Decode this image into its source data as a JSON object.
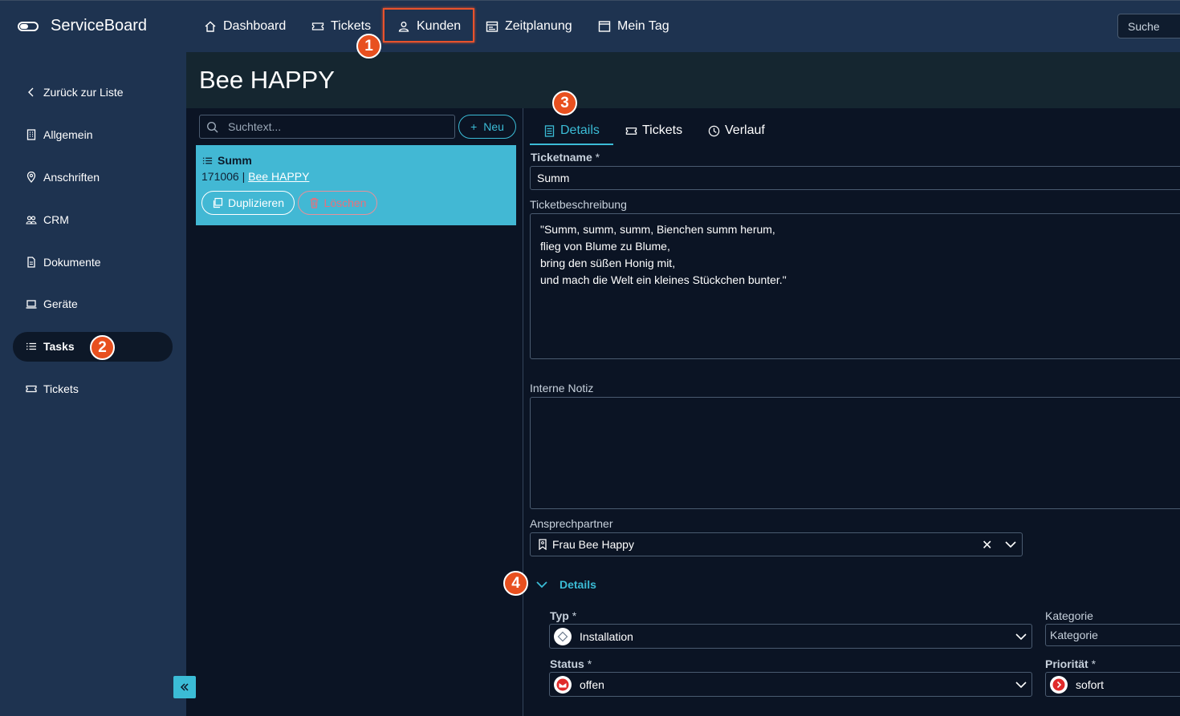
{
  "app": {
    "name": "ServiceBoard"
  },
  "nav": {
    "items": [
      {
        "label": "Dashboard"
      },
      {
        "label": "Tickets"
      },
      {
        "label": "Kunden"
      },
      {
        "label": "Zeitplanung"
      },
      {
        "label": "Mein Tag"
      }
    ],
    "search_label": "Suche"
  },
  "badges": [
    "1",
    "2",
    "3",
    "4"
  ],
  "sidebar": {
    "items": [
      {
        "label": "Zurück zur Liste"
      },
      {
        "label": "Allgemein"
      },
      {
        "label": "Anschriften"
      },
      {
        "label": "CRM"
      },
      {
        "label": "Dokumente"
      },
      {
        "label": "Geräte"
      },
      {
        "label": "Tasks"
      },
      {
        "label": "Tickets"
      }
    ],
    "active": "Tasks"
  },
  "page": {
    "title": "Bee HAPPY"
  },
  "list": {
    "search_placeholder": "Suchtext...",
    "new_label": "Neu",
    "card": {
      "title": "Summ",
      "number": "171006",
      "separator": "|",
      "customer": "Bee HAPPY",
      "duplicate_label": "Duplizieren",
      "delete_label": "Löschen"
    }
  },
  "tabs": [
    {
      "label": "Details"
    },
    {
      "label": "Tickets"
    },
    {
      "label": "Verlauf"
    }
  ],
  "form": {
    "ticketname_label": "Ticketname",
    "required_mark": "*",
    "ticketname_value": "Summ",
    "description_label": "Ticketbeschreibung",
    "description_lines": [
      "\"Summ, summ, summ, Bienchen summ herum,",
      "flieg von Blume zu Blume,",
      "bring den süßen Honig mit,",
      "und mach die Welt ein kleines Stückchen bunter.\""
    ],
    "note_label": "Interne Notiz",
    "contact_label": "Ansprechpartner",
    "contact_value": "Frau Bee Happy",
    "details_section": "Details",
    "typ_label": "Typ",
    "typ_value": "Installation",
    "kategorie_label": "Kategorie",
    "kategorie_placeholder": "Kategorie",
    "status_label": "Status",
    "status_value": "offen",
    "prio_label": "Priorität",
    "prio_value": "sofort"
  },
  "colors": {
    "accent": "#3bbcd6",
    "sidebar": "#1e3350",
    "background": "#0b1424",
    "badge": "#e8501f",
    "card": "#42b8d4"
  },
  "icons": [
    "home-icon",
    "ticket-icon",
    "user-icon",
    "calendar-icon",
    "window-icon",
    "chevron-left-icon",
    "building-icon",
    "pin-icon",
    "users-icon",
    "document-icon",
    "laptop-icon",
    "list-icon",
    "search-icon",
    "plus-icon",
    "copy-icon",
    "trash-icon",
    "form-icon",
    "clock-icon",
    "bookmark-icon",
    "close-icon",
    "chevron-down-icon",
    "double-chevron-left-icon"
  ]
}
